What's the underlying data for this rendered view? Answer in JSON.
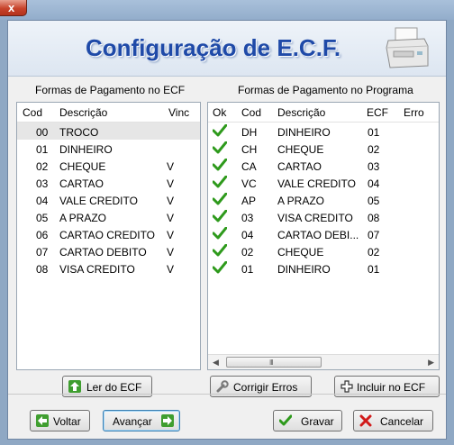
{
  "window": {
    "title": "Configuração de E.C.F.",
    "close_label": "x"
  },
  "left_panel": {
    "label": "Formas de Pagamento no ECF",
    "columns": [
      "Cod",
      "Descrição",
      "Vinc"
    ],
    "rows": [
      {
        "cod": "00",
        "desc": "TROCO",
        "vinc": ""
      },
      {
        "cod": "01",
        "desc": "DINHEIRO",
        "vinc": ""
      },
      {
        "cod": "02",
        "desc": "CHEQUE",
        "vinc": "V"
      },
      {
        "cod": "03",
        "desc": "CARTAO",
        "vinc": "V"
      },
      {
        "cod": "04",
        "desc": "VALE CREDITO",
        "vinc": "V"
      },
      {
        "cod": "05",
        "desc": "A PRAZO",
        "vinc": "V"
      },
      {
        "cod": "06",
        "desc": "CARTAO CREDITO",
        "vinc": "V"
      },
      {
        "cod": "07",
        "desc": "CARTAO DEBITO",
        "vinc": "V"
      },
      {
        "cod": "08",
        "desc": "VISA CREDITO",
        "vinc": "V"
      }
    ]
  },
  "right_panel": {
    "label": "Formas de Pagamento no Programa",
    "columns": [
      "Ok",
      "Cod",
      "Descrição",
      "ECF",
      "Erro"
    ],
    "rows": [
      {
        "ok": true,
        "cod": "DH",
        "desc": "DINHEIRO",
        "ecf": "01"
      },
      {
        "ok": true,
        "cod": "CH",
        "desc": "CHEQUE",
        "ecf": "02"
      },
      {
        "ok": true,
        "cod": "CA",
        "desc": "CARTAO",
        "ecf": "03"
      },
      {
        "ok": true,
        "cod": "VC",
        "desc": "VALE CREDITO",
        "ecf": "04"
      },
      {
        "ok": true,
        "cod": "AP",
        "desc": "A PRAZO",
        "ecf": "05"
      },
      {
        "ok": true,
        "cod": "03",
        "desc": "VISA CREDITO",
        "ecf": "08"
      },
      {
        "ok": true,
        "cod": "04",
        "desc": "CARTAO DEBI...",
        "ecf": "07"
      },
      {
        "ok": true,
        "cod": "02",
        "desc": "CHEQUE",
        "ecf": "02"
      },
      {
        "ok": true,
        "cod": "01",
        "desc": "DINHEIRO",
        "ecf": "01"
      }
    ],
    "scroll_grip": "III"
  },
  "buttons": {
    "ler_ecf": "Ler do ECF",
    "corrigir": "Corrigir Erros",
    "incluir": "Incluir no ECF",
    "voltar": "Voltar",
    "avancar": "Avançar",
    "gravar": "Gravar",
    "cancelar": "Cancelar"
  },
  "colors": {
    "title": "#1f4aa8",
    "check": "#2e9a1c",
    "cancel_x": "#d11b1b"
  }
}
